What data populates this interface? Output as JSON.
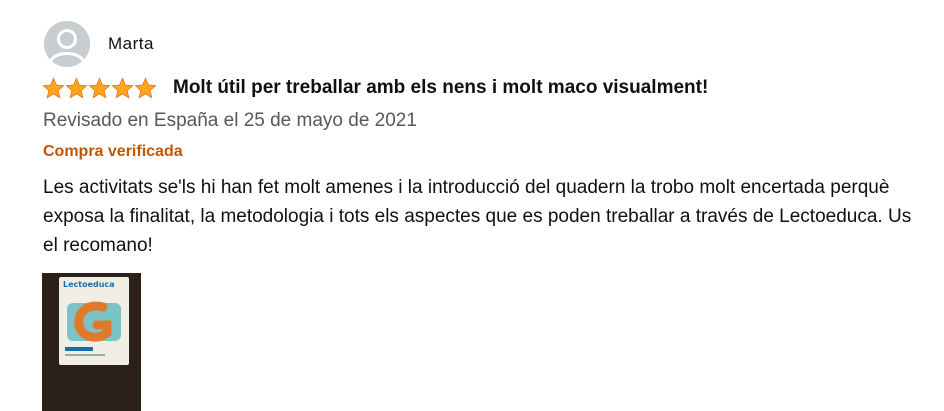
{
  "review": {
    "author_name": "Marta",
    "rating": 5,
    "rating_max": 5,
    "title": "Molt útil per treballar amb els nens i molt maco visualment!",
    "date": "Revisado en España el 25 de mayo de 2021",
    "verified_label": "Compra verificada",
    "body": "Les activitats se'ls hi han fet molt amenes i la introducció del quadern la trobo molt encertada perquè exposa la finalitat, la metodologia i tots els aspectes que es poden treballar a través de Lectoeduca. Us el recomano!",
    "image": {
      "label": "Lectoeduca",
      "icon": "book-photo-icon"
    },
    "colors": {
      "star": "#ffa41c",
      "verified": "#c45500",
      "date": "#565959",
      "avatar_bg": "#c8cdd1"
    }
  }
}
